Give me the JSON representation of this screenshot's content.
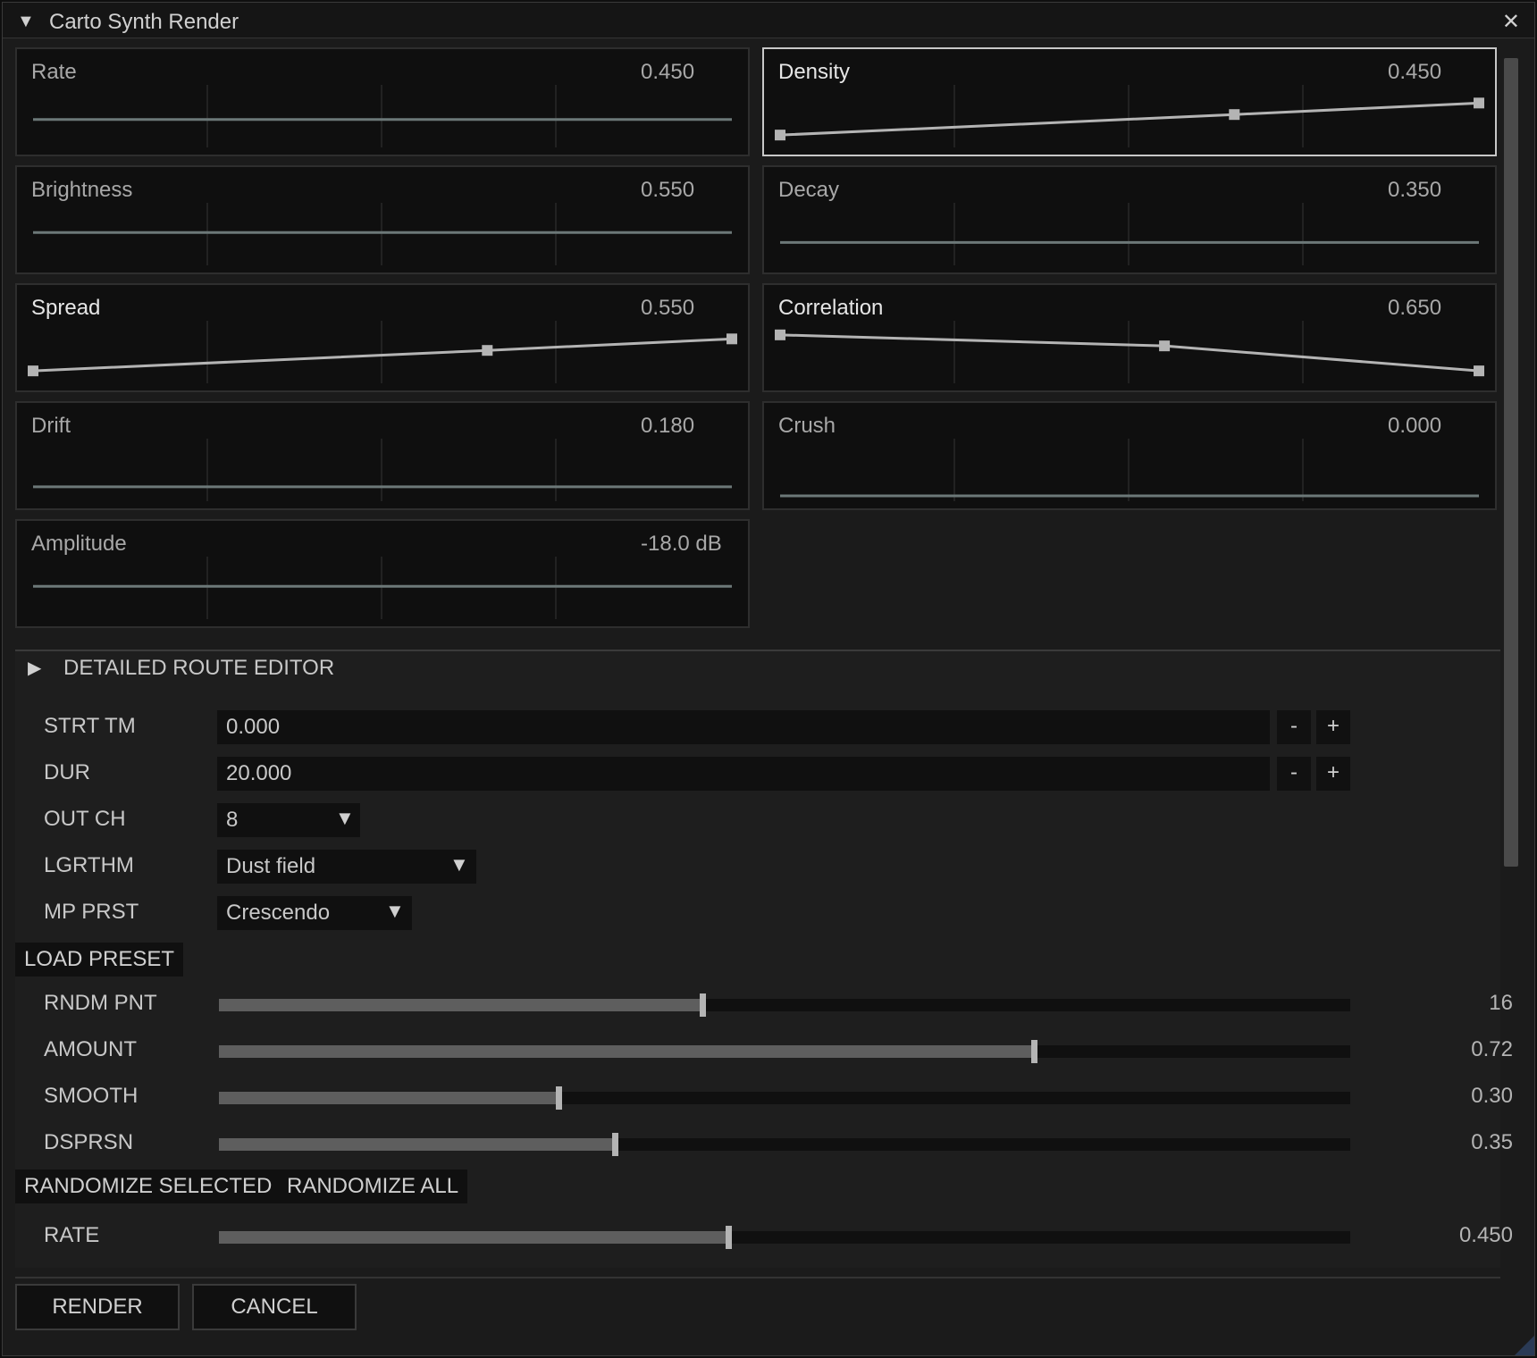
{
  "window": {
    "title": "Carto Synth Render",
    "collapse_glyph": "▼",
    "close_glyph": "✕"
  },
  "envelopes": [
    {
      "label": "Rate",
      "value": "0.450",
      "points": []
    },
    {
      "label": "Density",
      "value": "0.450",
      "points": [
        [
          0,
          0.14
        ],
        [
          0.65,
          0.55
        ],
        [
          1,
          0.78
        ]
      ]
    },
    {
      "label": "Brightness",
      "value": "0.550",
      "points": []
    },
    {
      "label": "Decay",
      "value": "0.350",
      "points": []
    },
    {
      "label": "Spread",
      "value": "0.550",
      "points": [
        [
          0,
          0.14
        ],
        [
          0.65,
          0.55
        ],
        [
          1,
          0.78
        ]
      ]
    },
    {
      "label": "Correlation",
      "value": "0.650",
      "points": [
        [
          0,
          0.86
        ],
        [
          0.55,
          0.64
        ],
        [
          1,
          0.14
        ]
      ]
    },
    {
      "label": "Drift",
      "value": "0.180",
      "points": []
    },
    {
      "label": "Crush",
      "value": "0.000",
      "points": []
    },
    {
      "label": "Amplitude",
      "value": "-18.0 dB",
      "points": []
    }
  ],
  "route_editor": {
    "expand_glyph": "▶",
    "title": "DETAILED ROUTE EDITOR",
    "start_time": {
      "label": "STRT TM",
      "value": "0.000"
    },
    "duration": {
      "label": "DUR",
      "value": "20.000"
    },
    "stepper": {
      "minus": "-",
      "plus": "+"
    },
    "out_channels": {
      "label": "OUT CH",
      "value": "8"
    },
    "algorithm": {
      "label": "LGRTHM",
      "value": "Dust field"
    },
    "map_preset": {
      "label": "MP PRST",
      "value": "Crescendo"
    },
    "combo_glyph": "▼",
    "load_preset": "LOAD PRESET",
    "sliders": [
      {
        "label": "RNDM PNT",
        "value": "16",
        "fraction": 0.427
      },
      {
        "label": "AMOUNT",
        "value": "0.72",
        "fraction": 0.72
      },
      {
        "label": "SMOOTH",
        "value": "0.30",
        "fraction": 0.3
      },
      {
        "label": "DSPRSN",
        "value": "0.35",
        "fraction": 0.35
      }
    ],
    "randomize_selected": "RANDOMIZE SELECTED",
    "randomize_all": "RANDOMIZE ALL",
    "rate": {
      "label": "RATE",
      "value": "0.450",
      "fraction": 0.45
    }
  },
  "footer": {
    "render": "RENDER",
    "cancel": "CANCEL"
  },
  "colors": {
    "background": "#1b1b1b",
    "panel": "#0f0f0f",
    "curve": "#b4b4b4",
    "flat_line": "#6c7878"
  }
}
